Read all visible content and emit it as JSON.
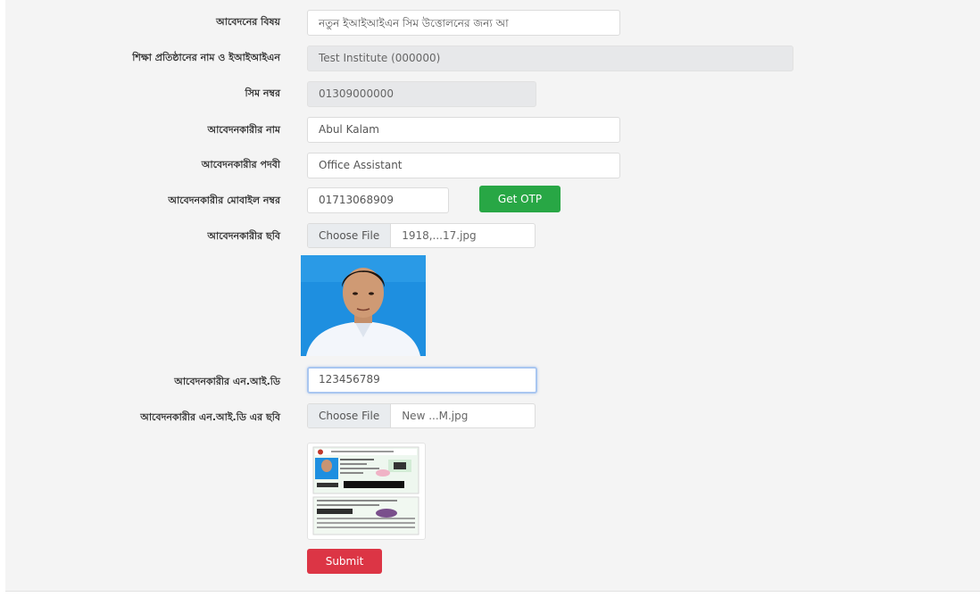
{
  "form": {
    "subject": {
      "label": "আবেদনের বিষয়",
      "value": "নতুন ইআইআইএন সিম উত্তোলনের জন্য আ"
    },
    "institute": {
      "label": "শিক্ষা প্রতিষ্ঠানের নাম ও ইআইআইএন",
      "value": "Test Institute (000000)"
    },
    "sim": {
      "label": "সিম নম্বর",
      "value": "01309000000"
    },
    "applicant_name": {
      "label": "আবেদনকারীর নাম",
      "value": "Abul Kalam"
    },
    "designation": {
      "label": "আবেদনকারীর পদবী",
      "value": "Office Assistant"
    },
    "mobile": {
      "label": "আবেদনকারীর মোবাইল নম্বর",
      "value": "01713068909",
      "otp_button": "Get OTP"
    },
    "photo": {
      "label": "আবেদনকারীর ছবি",
      "choose": "Choose File",
      "filename": "1918,...17.jpg"
    },
    "nid": {
      "label": "আবেদনকারীর এন.আই.ডি",
      "value": "123456789"
    },
    "nid_photo": {
      "label": "আবেদনকারীর এন.আই.ডি এর ছবি",
      "choose": "Choose File",
      "filename": "New ...M.jpg"
    },
    "submit": "Submit"
  },
  "colors": {
    "otp_green": "#28a745",
    "submit_red": "#dc3545",
    "photo_bg_blue": "#1e8fe0"
  }
}
